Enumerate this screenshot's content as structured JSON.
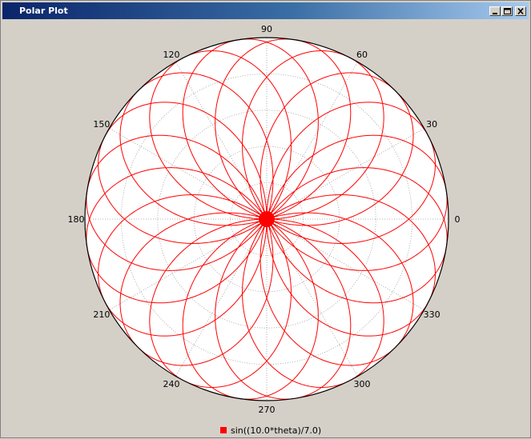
{
  "window": {
    "title": "Polar Plot"
  },
  "chart_data": {
    "type": "line",
    "projection": "polar",
    "angle_unit": "degrees",
    "angle_ticks": [
      0,
      30,
      60,
      90,
      120,
      150,
      180,
      210,
      240,
      270,
      300,
      330
    ],
    "radial_range": [
      0,
      1
    ],
    "grid": true,
    "legend_position": "bottom",
    "series": [
      {
        "name": "sin((10.0*theta)/7.0)",
        "color": "#ff0000",
        "function": "r = sin(10*theta/7)",
        "theta_range_radians": [
          0,
          43.98
        ]
      }
    ]
  },
  "colors": {
    "plot_background": "#ffffff",
    "outer_circle": "#000000",
    "grid": "#9a9a9a",
    "series": "#ff0000"
  }
}
